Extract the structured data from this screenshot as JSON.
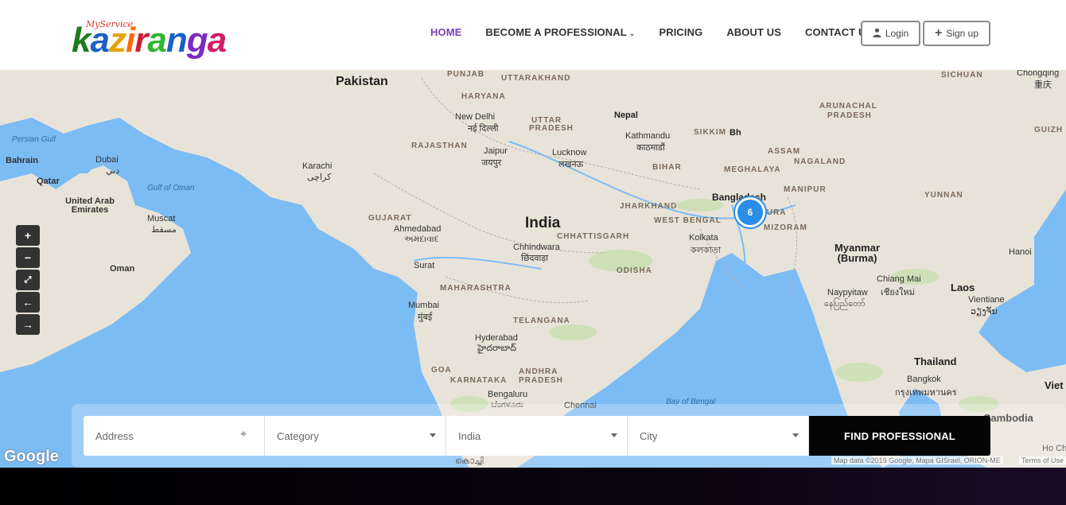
{
  "brand": {
    "tagline": "MyService",
    "letters": [
      {
        "ch": "k",
        "color": "#1e7a1e"
      },
      {
        "ch": "a",
        "color": "#1b5fcb"
      },
      {
        "ch": "z",
        "color": "#e4a500"
      },
      {
        "ch": "i",
        "color": "#ff6a00"
      },
      {
        "ch": "r",
        "color": "#cc1f3a"
      },
      {
        "ch": "a",
        "color": "#33b533"
      },
      {
        "ch": "n",
        "color": "#1b5fcb"
      },
      {
        "ch": "g",
        "color": "#7a2cc4"
      },
      {
        "ch": "a",
        "color": "#d21c6a"
      }
    ]
  },
  "nav": {
    "home": "HOME",
    "become": "BECOME A PROFESSIONAL",
    "pricing": "PRICING",
    "about": "ABOUT US",
    "contact": "CONTACT US",
    "active_color": "#7d3cbd"
  },
  "auth": {
    "login": "Login",
    "signup": "Sign up"
  },
  "map": {
    "cluster_count": "6",
    "labels": {
      "pakistan": "Pakistan",
      "punjab": "PUNJAB",
      "uttarakhand": "UTTARAKHAND",
      "haryana": "HARYANA",
      "new_delhi": "New Delhi",
      "new_delhi_local": "नई दिल्ली",
      "uttar_pradesh": "UTTAR PRADESH",
      "nepal": "Nepal",
      "kathmandu": "Kathmandu",
      "kathmandu_local": "काठमाडौं",
      "sikkim": "SIKKIM",
      "bhutan_partial": "Bh",
      "arunachal": "ARUNACHAL PRADESH",
      "sichuan": "SICHUAN",
      "chongqing": "Chongqing",
      "chongqing_local": "重庆",
      "guizhou": "GUIZH",
      "persian_gulf": "Persian Gulf",
      "bahrain": "Bahrain",
      "dubai": "Dubai",
      "dubai_local": "دبي",
      "qatar": "Qatar",
      "uae": "United Arab Emirates",
      "gulf_oman": "Gulf of Oman",
      "muscat": "Muscat",
      "muscat_local": "مسقط",
      "oman": "Oman",
      "karachi": "Karachi",
      "karachi_local": "کراچی",
      "rajasthan": "RAJASTHAN",
      "jaipur": "Jaipur",
      "jaipur_local": "जयपुर",
      "lucknow": "Lucknow",
      "lucknow_local": "लखनऊ",
      "bihar": "BIHAR",
      "assam": "ASSAM",
      "meghalaya": "MEGHALAYA",
      "nagaland": "NAGALAND",
      "bangladesh": "Bangladesh",
      "manipur": "MANIPUR",
      "yunnan": "YUNNAN",
      "tripura": "TRIPURA",
      "mizoram": "MIZORAM",
      "gujarat": "GUJARAT",
      "ahmedabad": "Ahmedabad",
      "ahmedabad_local": "અમદાવાદ",
      "india": "India",
      "jharkhand": "JHARKHAND",
      "west_bengal": "WEST BENGAL",
      "kolkata": "Kolkata",
      "kolkata_local": "কলকাতা",
      "chhindwara": "Chhindwara",
      "chhindwara_local": "छिंदवाड़ा",
      "chhattisgarh": "CHHATTISGARH",
      "surat": "Surat",
      "myanmar": "Myanmar (Burma)",
      "hanoi": "Hanoi",
      "maharashtra": "MAHARASHTRA",
      "odisha": "ODISHA",
      "chiang_mai": "Chiang Mai",
      "chiang_mai_local": "เชียงใหม่",
      "laos": "Laos",
      "naypyitaw": "Naypyitaw",
      "naypyitaw_local": "နေပြည်တော်",
      "vientiane": "Vientiane",
      "vientiane_local": "ວຽງຈັນ",
      "mumbai": "Mumbai",
      "mumbai_local": "मुंबई",
      "telangana": "TELANGANA",
      "hyderabad": "Hyderabad",
      "hyderabad_local": "హైదరాబాద్",
      "goa": "GOA",
      "andhra": "ANDHRA PRADESH",
      "karnataka": "KARNATAKA",
      "thailand": "Thailand",
      "bangkok": "Bangkok",
      "bangkok_local": "กรุงเทพมหานคร",
      "viet": "Viet",
      "bengaluru": "Bengaluru",
      "bengaluru_local": "ಬೆಂಗಳೂರು",
      "chennai": "Chennai",
      "bay_bengal": "Bay of Bengal",
      "cambodia": "Cambodia",
      "hochi": "Ho Ch",
      "kochi_local": "കൊച്ചി",
      "google": "Google",
      "mapdata": "Map data ©2019 Google, Mapa GISrael, ORION-ME",
      "terms": "Terms of Use"
    }
  },
  "search": {
    "address_placeholder": "Address",
    "category": "Category",
    "country": "India",
    "city": "City",
    "find": "FIND PROFESSIONAL"
  }
}
